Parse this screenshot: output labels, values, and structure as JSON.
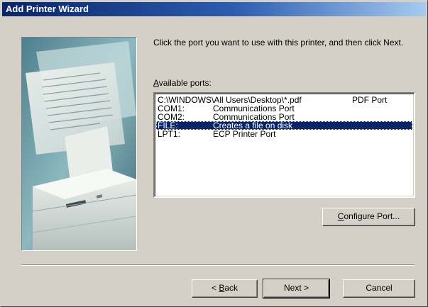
{
  "window": {
    "title": "Add Printer Wizard"
  },
  "instruction": "Click the port you want to use with this printer, and then click Next.",
  "ports_label": {
    "mnemonic": "A",
    "rest": "vailable ports:"
  },
  "ports": [
    {
      "name": "C:\\WINDOWS\\All Users\\Desktop\\*.pdf",
      "description": "",
      "extra": "PDF Port",
      "selected": false
    },
    {
      "name": "COM1:",
      "description": "Communications Port",
      "extra": "",
      "selected": false
    },
    {
      "name": "COM2:",
      "description": "Communications Port",
      "extra": "",
      "selected": false
    },
    {
      "name": "FILE:",
      "description": "Creates a file on disk",
      "extra": "",
      "selected": true
    },
    {
      "name": "LPT1:",
      "description": "ECP Printer Port",
      "extra": "",
      "selected": false
    }
  ],
  "buttons": {
    "configure": {
      "mnemonic": "C",
      "rest": "onfigure Port..."
    },
    "back": {
      "prefix": "< ",
      "mnemonic": "B",
      "rest": "ack"
    },
    "next": "Next >",
    "cancel": "Cancel"
  },
  "colors": {
    "title_bar": "#0a246a",
    "selection": "#0a246a",
    "dialog_face": "#d4d0c8"
  },
  "icons": {
    "illustration": "printer-illustration"
  }
}
